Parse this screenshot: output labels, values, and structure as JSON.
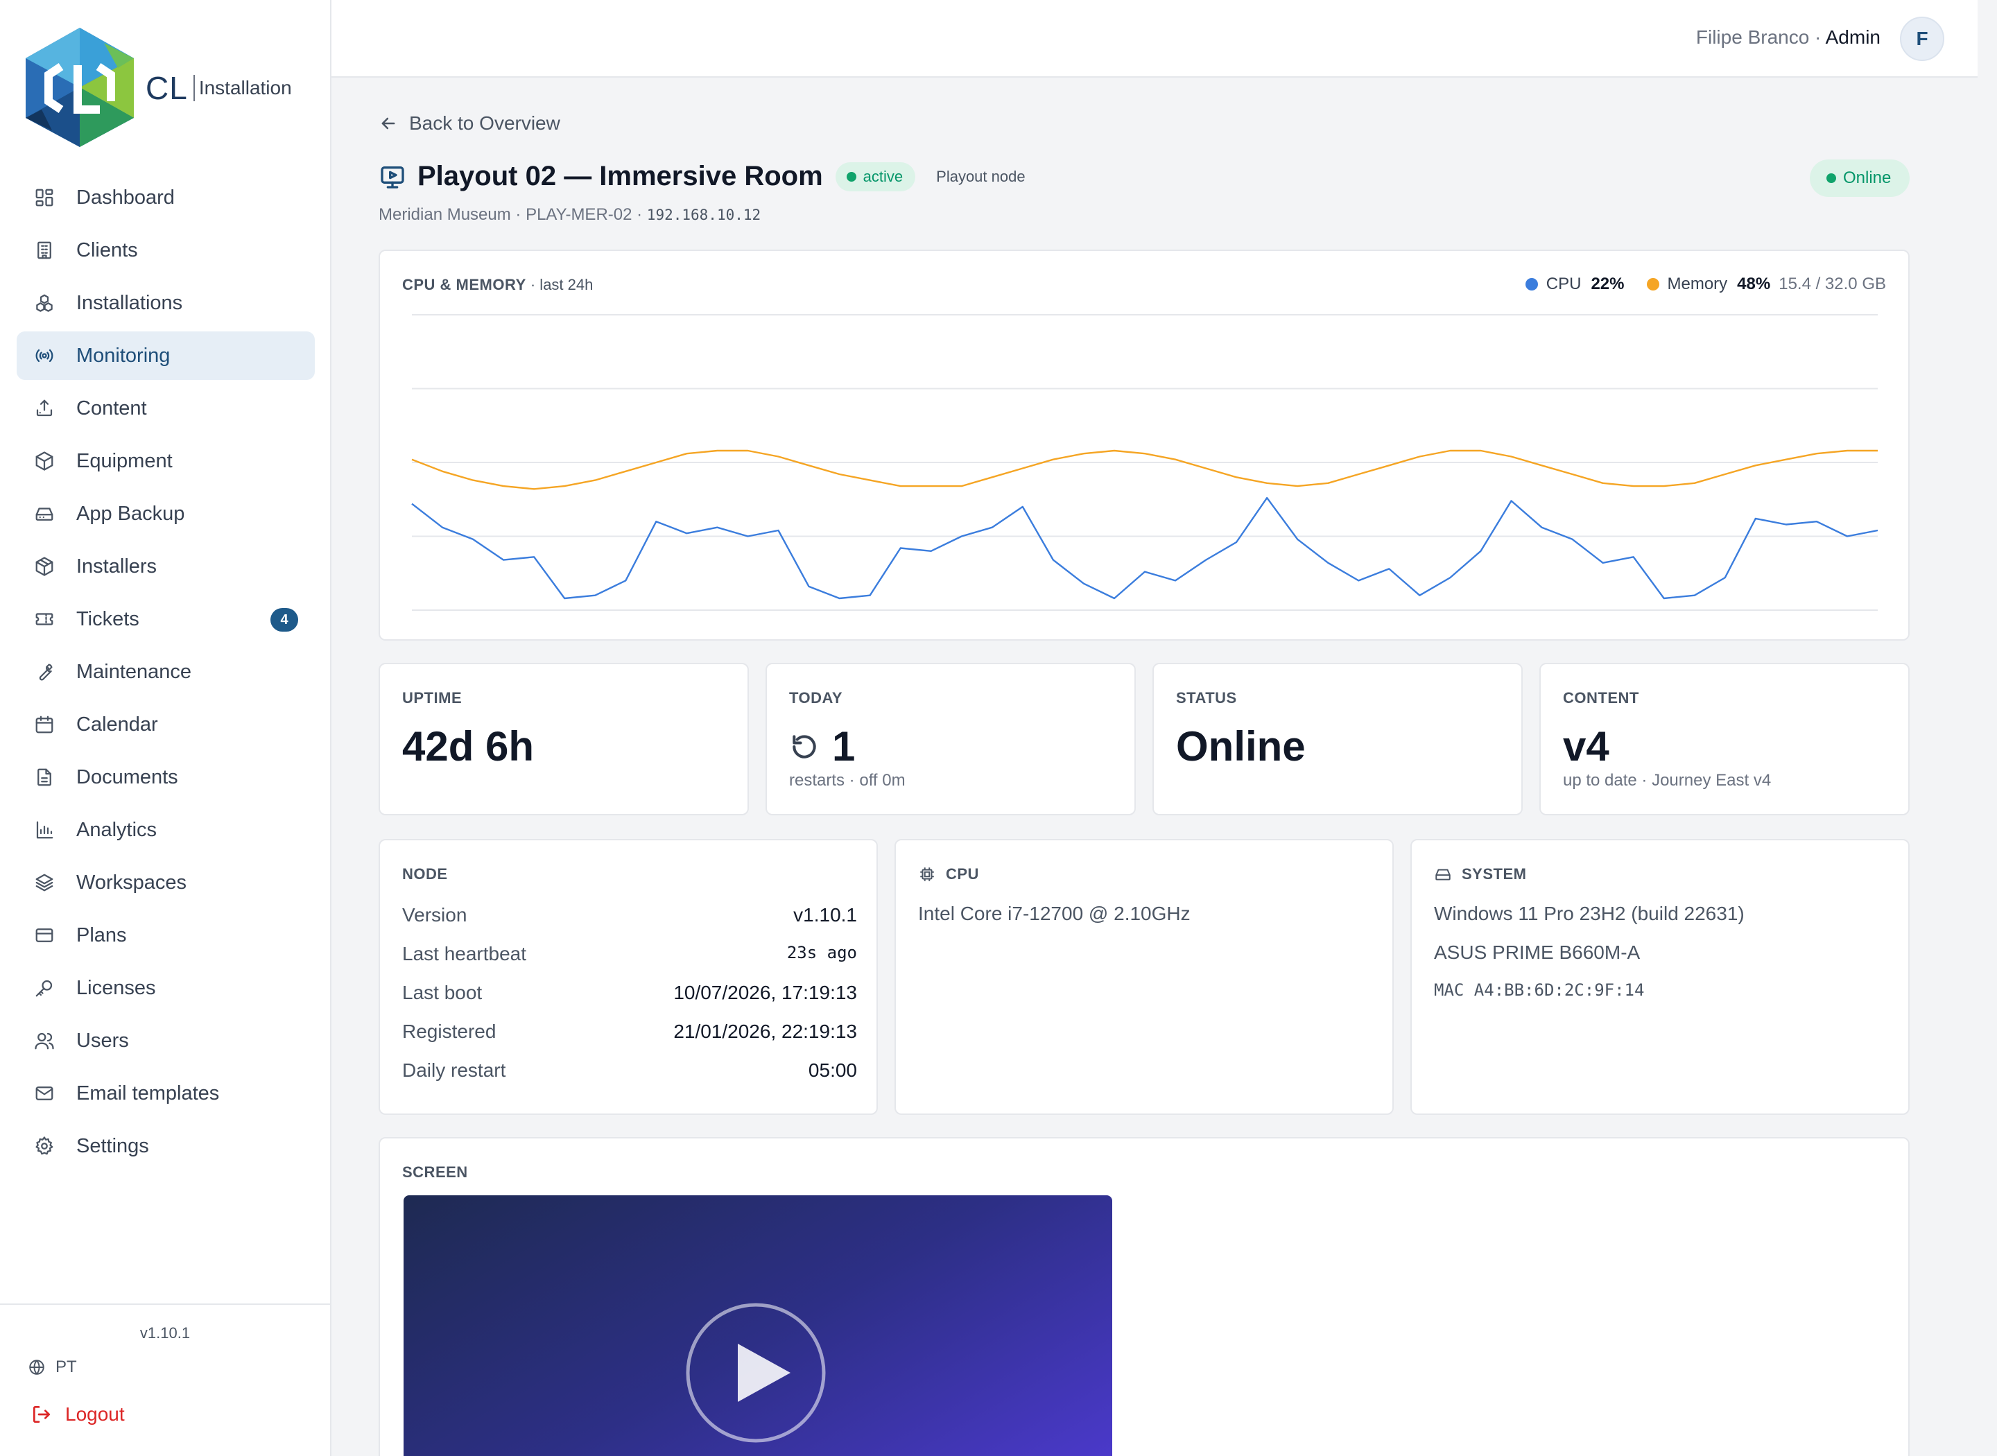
{
  "brand": {
    "logo_text": "CL",
    "logo_subtitle": "Installation"
  },
  "sidebar": {
    "items": [
      {
        "label": "Dashboard",
        "icon": "dashboard-icon"
      },
      {
        "label": "Clients",
        "icon": "building-icon"
      },
      {
        "label": "Installations",
        "icon": "cubes-icon"
      },
      {
        "label": "Monitoring",
        "icon": "broadcast-icon",
        "active": true
      },
      {
        "label": "Content",
        "icon": "upload-icon"
      },
      {
        "label": "Equipment",
        "icon": "box-icon"
      },
      {
        "label": "App Backup",
        "icon": "hard-drive-icon"
      },
      {
        "label": "Installers",
        "icon": "package-icon"
      },
      {
        "label": "Tickets",
        "icon": "ticket-icon",
        "badge": "4"
      },
      {
        "label": "Maintenance",
        "icon": "wrench-icon"
      },
      {
        "label": "Calendar",
        "icon": "calendar-icon"
      },
      {
        "label": "Documents",
        "icon": "document-icon"
      },
      {
        "label": "Analytics",
        "icon": "bar-chart-icon"
      },
      {
        "label": "Workspaces",
        "icon": "layers-icon"
      },
      {
        "label": "Plans",
        "icon": "credit-card-icon"
      },
      {
        "label": "Licenses",
        "icon": "key-icon"
      },
      {
        "label": "Users",
        "icon": "users-icon"
      },
      {
        "label": "Email templates",
        "icon": "mail-icon"
      },
      {
        "label": "Settings",
        "icon": "gear-icon"
      }
    ],
    "version": "v1.10.1",
    "language": "PT",
    "logout_label": "Logout"
  },
  "topbar": {
    "user_name": "Filipe Branco",
    "separator": " · ",
    "user_role": "Admin",
    "avatar_initial": "F"
  },
  "back_link": "Back to Overview",
  "device": {
    "title": "Playout 02 — Immersive Room",
    "state_badge": "active",
    "type_badge": "Playout node",
    "subtitle": "Meridian Museum · PLAY-MER-02 · ",
    "ip": "192.168.10.12",
    "status_pill": "Online"
  },
  "chart_card": {
    "label": "CPU & MEMORY",
    "period": " · last 24h",
    "legend": {
      "cpu_label": "CPU",
      "cpu_value": "22%",
      "memory_label": "Memory",
      "memory_value": "48%",
      "memory_detail": "15.4 / 32.0 GB"
    }
  },
  "chart_data": {
    "type": "line",
    "ylim": [
      0,
      100
    ],
    "grid": true,
    "series": [
      {
        "name": "CPU",
        "color": "#3b7ddd",
        "values": [
          36,
          28,
          24,
          17,
          18,
          4,
          5,
          10,
          30,
          26,
          28,
          25,
          27,
          8,
          4,
          5,
          21,
          20,
          25,
          28,
          35,
          17,
          9,
          4,
          13,
          10,
          17,
          23,
          38,
          24,
          16,
          10,
          14,
          5,
          11,
          20,
          37,
          28,
          24,
          16,
          18,
          4,
          5,
          11,
          31,
          29,
          30,
          25,
          27
        ]
      },
      {
        "name": "Memory",
        "color": "#f5a524",
        "values": [
          51,
          47,
          44,
          42,
          41,
          42,
          44,
          47,
          50,
          53,
          54,
          54,
          52,
          49,
          46,
          44,
          42,
          42,
          42,
          45,
          48,
          51,
          53,
          54,
          53,
          51,
          48,
          45,
          43,
          42,
          43,
          46,
          49,
          52,
          54,
          54,
          52,
          49,
          46,
          43,
          42,
          42,
          43,
          46,
          49,
          51,
          53,
          54,
          54
        ]
      }
    ]
  },
  "stats": {
    "uptime": {
      "label": "UPTIME",
      "value": "42d 6h"
    },
    "today": {
      "label": "TODAY",
      "value": "1",
      "sub": "restarts · off 0m"
    },
    "status": {
      "label": "STATUS",
      "value": "Online"
    },
    "content": {
      "label": "CONTENT",
      "value": "v4",
      "sub": "up to date · Journey East v4"
    }
  },
  "node": {
    "label": "NODE",
    "rows": [
      {
        "key": "Version",
        "value": "v1.10.1"
      },
      {
        "key": "Last heartbeat",
        "value": "23s ago"
      },
      {
        "key": "Last boot",
        "value": "10/07/2026, 17:19:13"
      },
      {
        "key": "Registered",
        "value": "21/01/2026, 22:19:13"
      },
      {
        "key": "Daily restart",
        "value": "05:00"
      }
    ]
  },
  "cpu": {
    "label": "CPU",
    "model": "Intel Core i7-12700 @ 2.10GHz"
  },
  "system": {
    "label": "SYSTEM",
    "os": "Windows 11 Pro 23H2 (build 22631)",
    "board": "ASUS PRIME B660M-A",
    "mac": "MAC A4:BB:6D:2C:9F:14"
  },
  "screen": {
    "label": "SCREEN"
  }
}
